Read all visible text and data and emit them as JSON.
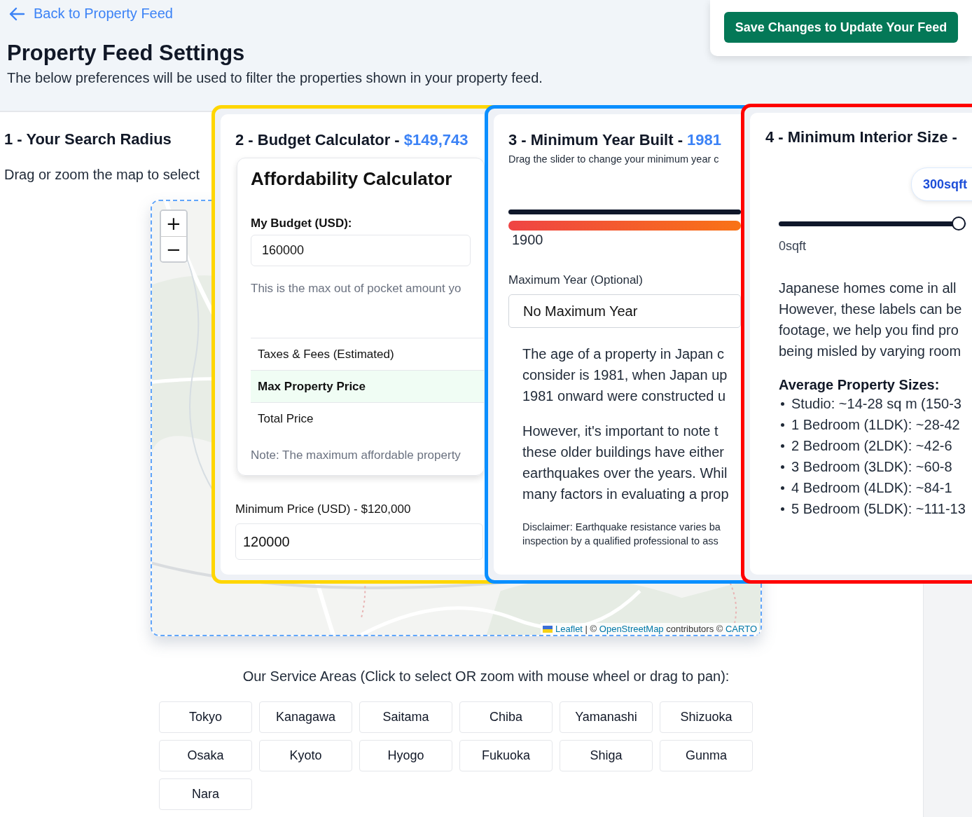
{
  "back_link": "Back to Property Feed",
  "save_button": "Save Changes to Update Your Feed",
  "page": {
    "title": "Property Feed Settings",
    "subtitle": "The below preferences will be used to filter the properties shown in your property feed."
  },
  "search_radius": {
    "heading": "1 - Your Search Radius",
    "description": "Drag or zoom the map to select",
    "map": {
      "kind": "picture",
      "zoom_in": "+",
      "zoom_out": "−",
      "attribution": [
        {
          "kind": "link",
          "text": "Leaflet"
        },
        {
          "kind": "text",
          "text": "| ©"
        },
        {
          "kind": "link",
          "text": "OpenStreetMap"
        },
        {
          "kind": "text",
          "text": "contributors ©"
        },
        {
          "kind": "link",
          "text": "CARTO"
        }
      ]
    }
  },
  "budget": {
    "title": "2 - Budget Calculator -",
    "amount": "$149,743",
    "calculator": {
      "title": "Affordability Calculator",
      "budget_label": "My Budget (USD):",
      "budget_value": "160000",
      "help": "This is the max out of pocket amount yo",
      "rows": [
        {
          "label": "Taxes & Fees (Estimated)",
          "highlighted": false
        },
        {
          "label": "Max Property Price",
          "highlighted": true
        },
        {
          "label": "Total Price",
          "highlighted": false
        }
      ],
      "note": "Note: The maximum affordable property"
    },
    "min_price_label": "Minimum Price (USD) - $120,000",
    "min_price_value": "120000"
  },
  "year": {
    "title": "3 - Minimum Year Built -",
    "value": "1981",
    "hint": "Drag the slider to change your minimum year c",
    "range_start": "1900",
    "max_label": "Maximum Year (Optional)",
    "max_value": "No Maximum Year",
    "paragraphs": [
      [
        "The age of a property in Japan c",
        "consider is 1981, when Japan up",
        "1981 onward were constructed u"
      ],
      [
        "However, it's important to note t",
        "these older buildings have either",
        "earthquakes over the years. Whil",
        "many factors in evaluating a prop"
      ]
    ],
    "disclaimer": [
      "Disclaimer: Earthquake resistance varies ba",
      "inspection by a qualified professional to ass"
    ]
  },
  "size": {
    "title": "4 - Minimum Interior Size -",
    "value": "300sqft",
    "level": 0.96,
    "min_label": "0sqft",
    "intro": [
      "Japanese homes come in all",
      "However, these labels can be",
      "footage, we help you find pro",
      "being misled by varying room"
    ],
    "sizes_heading": "Average Property Sizes:",
    "sizes": [
      "Studio: ~14-28 sq m (150-3",
      "1 Bedroom (1LDK): ~28-42",
      "2 Bedroom (2LDK): ~42-6",
      "3 Bedroom (3LDK): ~60-8",
      "4 Bedroom (4LDK): ~84-1",
      "5 Bedroom (5LDK): ~111-13"
    ]
  },
  "service_areas": {
    "heading": "Our Service Areas (Click to select OR zoom with mouse wheel or drag to pan):",
    "areas": [
      "Tokyo",
      "Kanagawa",
      "Saitama",
      "Chiba",
      "Yamanashi",
      "Shizuoka",
      "Osaka",
      "Kyoto",
      "Hyogo",
      "Fukuoka",
      "Shiga",
      "Gunma",
      "Nara"
    ]
  }
}
